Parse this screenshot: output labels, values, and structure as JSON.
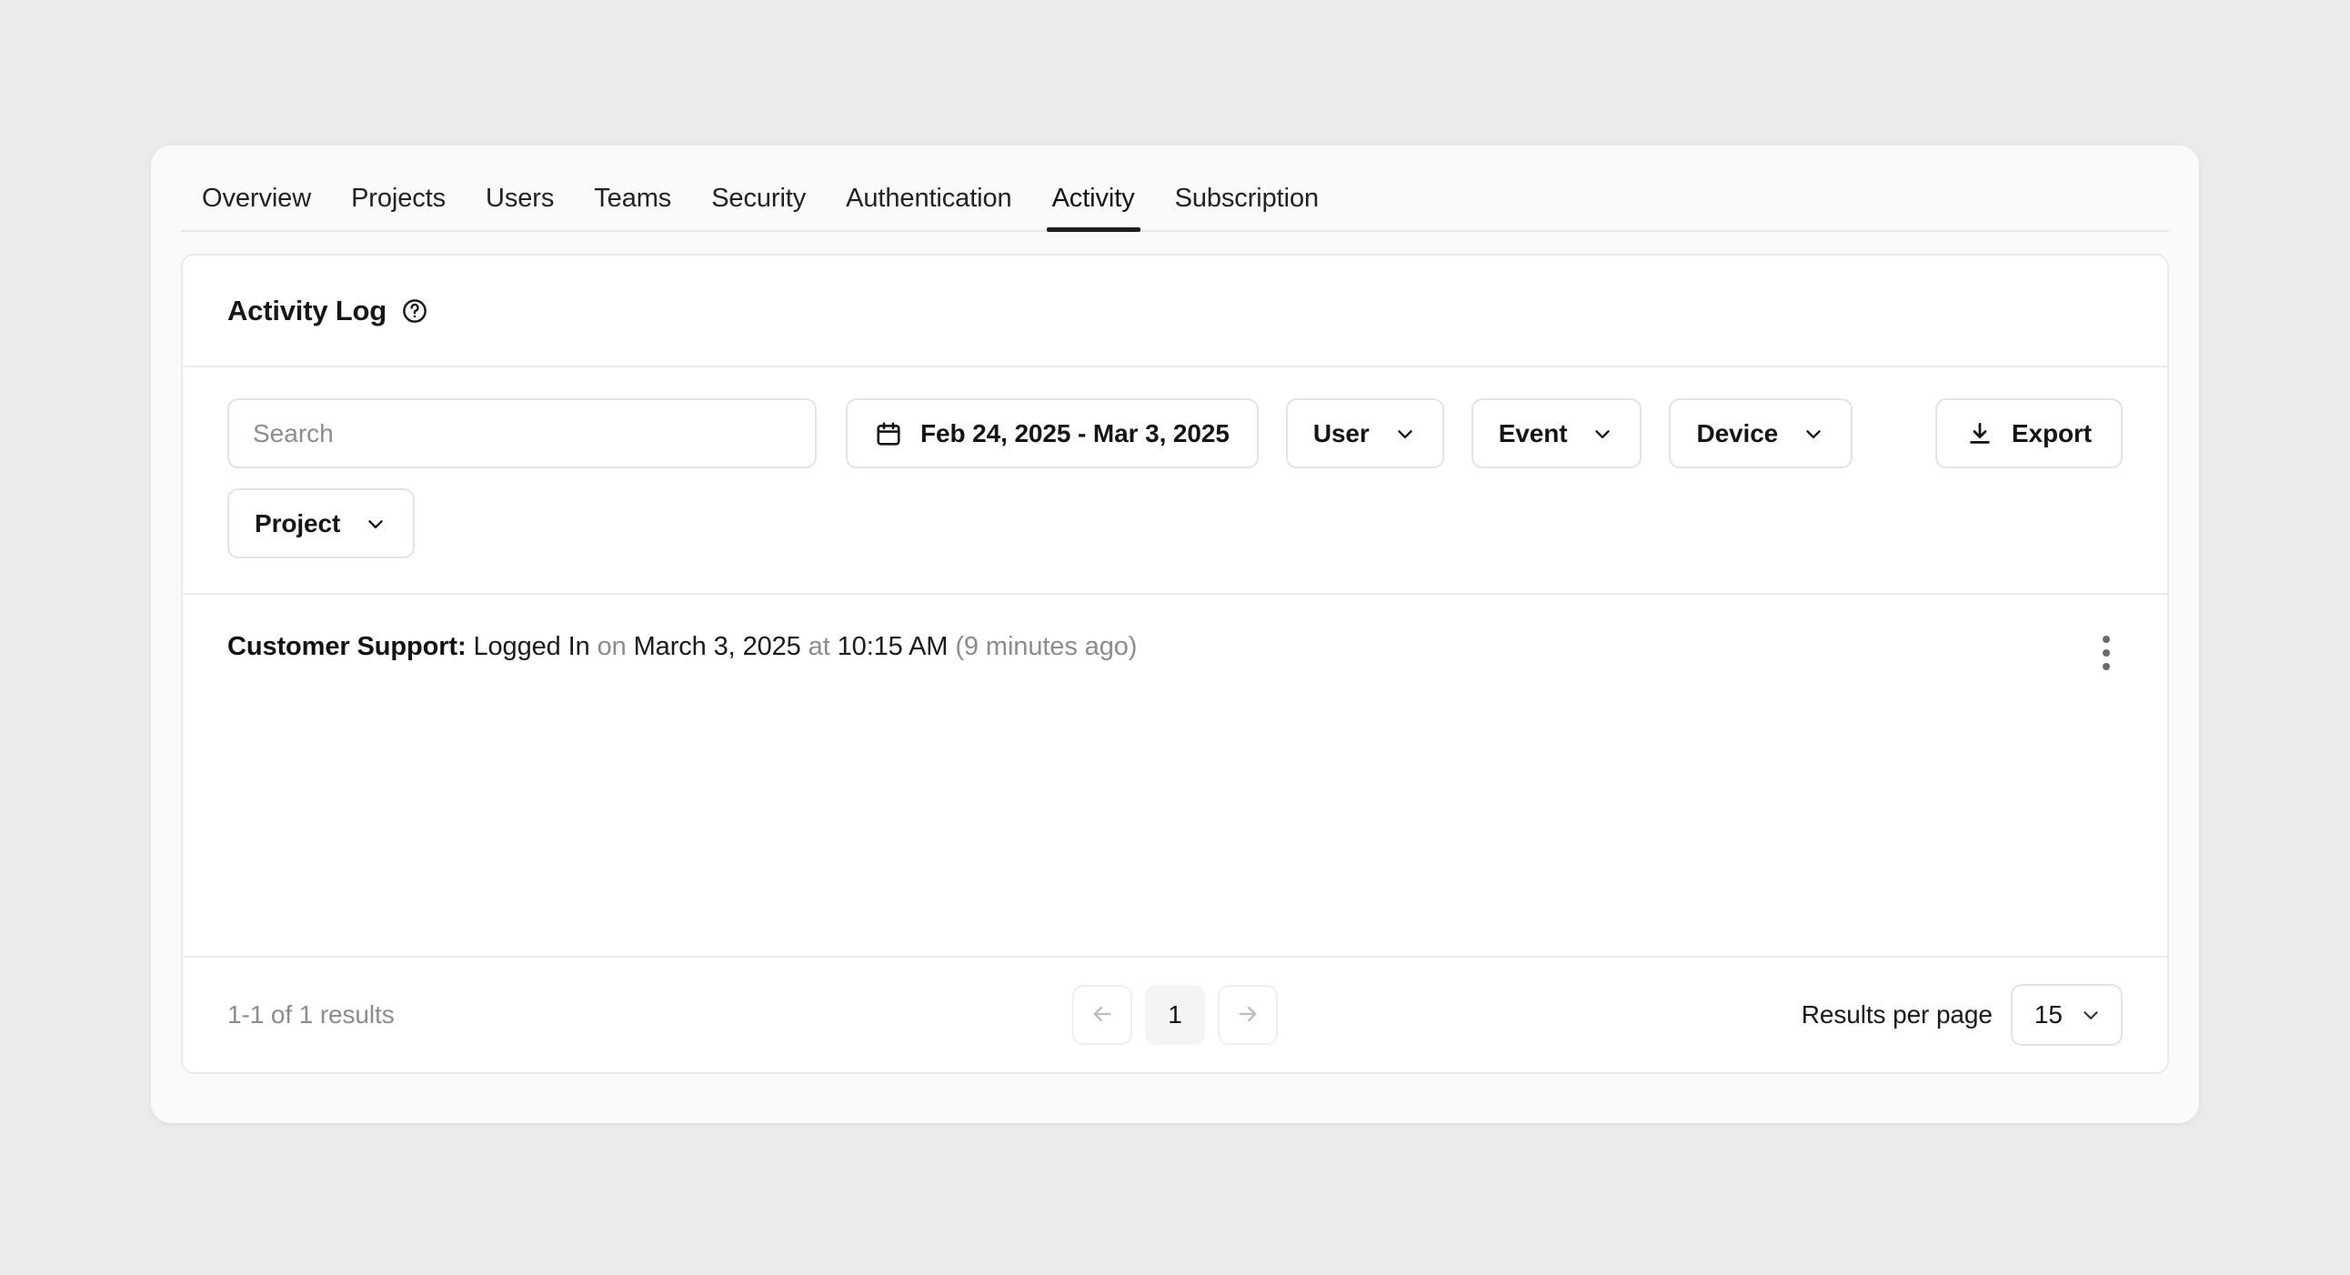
{
  "tabs": [
    {
      "label": "Overview",
      "active": false
    },
    {
      "label": "Projects",
      "active": false
    },
    {
      "label": "Users",
      "active": false
    },
    {
      "label": "Teams",
      "active": false
    },
    {
      "label": "Security",
      "active": false
    },
    {
      "label": "Authentication",
      "active": false
    },
    {
      "label": "Activity",
      "active": true
    },
    {
      "label": "Subscription",
      "active": false
    }
  ],
  "card": {
    "title": "Activity Log",
    "help_icon": "help-circle-icon"
  },
  "filters": {
    "search": {
      "placeholder": "Search",
      "value": "",
      "icon": "search-field"
    },
    "date_range": {
      "label": "Feb 24, 2025 - Mar 3, 2025",
      "icon": "calendar-icon"
    },
    "user": {
      "label": "User",
      "icon": "chevron-down-icon"
    },
    "event": {
      "label": "Event",
      "icon": "chevron-down-icon"
    },
    "device": {
      "label": "Device",
      "icon": "chevron-down-icon"
    },
    "project": {
      "label": "Project",
      "icon": "chevron-down-icon"
    },
    "export": {
      "label": "Export",
      "icon": "download-icon"
    }
  },
  "log": {
    "entries": [
      {
        "actor": "Customer Support:",
        "action": "Logged In",
        "on_word": "on",
        "date": "March 3, 2025",
        "at_word": "at",
        "time": "10:15 AM",
        "relative": "(9 minutes ago)",
        "menu_icon": "kebab-menu-icon"
      }
    ]
  },
  "footer": {
    "results_count": "1-1 of 1 results",
    "prev_icon": "arrow-left-icon",
    "next_icon": "arrow-right-icon",
    "current_page": "1",
    "per_page_label": "Results per page",
    "per_page_value": "15",
    "per_page_icon": "chevron-down-icon"
  },
  "colors": {
    "page_bg": "#ebebeb",
    "shell_bg": "#fafafa",
    "card_bg": "#ffffff",
    "border": "#eaeaea",
    "text": "#1a1a1a",
    "muted": "#8c8c8c",
    "active_tab_underline": "#1d1d1d"
  }
}
